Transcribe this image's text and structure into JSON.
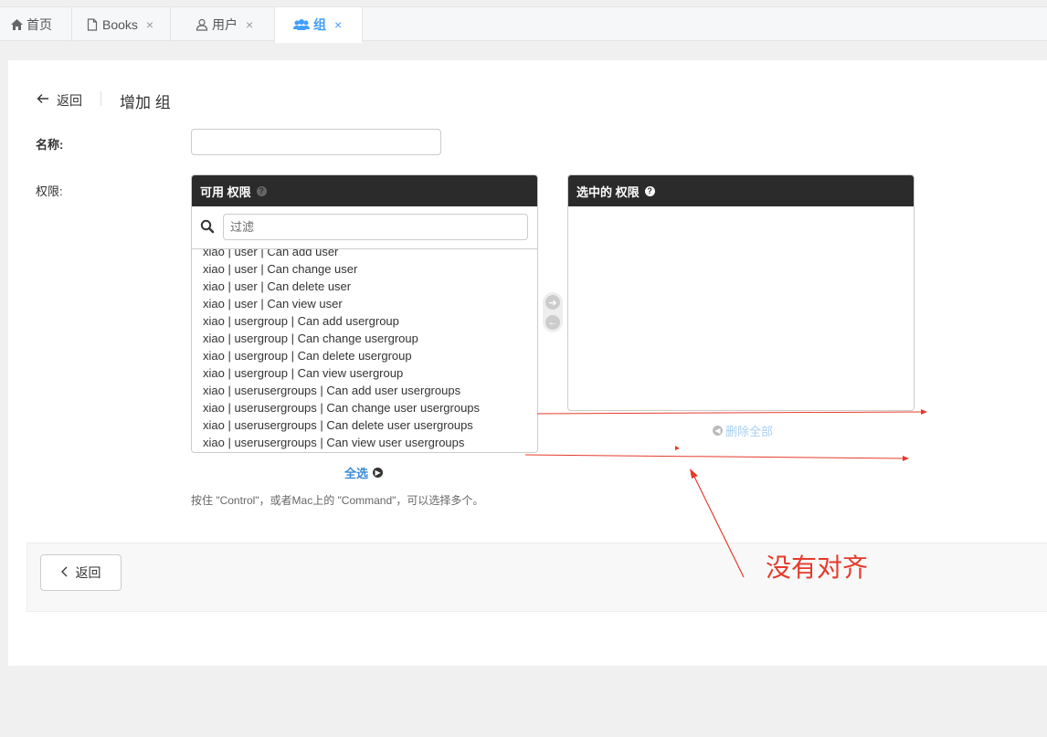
{
  "tabs": [
    {
      "label": "首页",
      "icon": "home-icon",
      "closable": false,
      "active": false
    },
    {
      "label": "Books",
      "icon": "file-icon",
      "closable": true,
      "active": false
    },
    {
      "label": "用户",
      "icon": "user-icon",
      "closable": true,
      "active": false
    },
    {
      "label": "组",
      "icon": "users-icon",
      "closable": true,
      "active": true
    }
  ],
  "tab_close_glyph": "×",
  "header": {
    "back_label": "返回",
    "title": "增加 组"
  },
  "form": {
    "name_label": "名称:",
    "name_value": "",
    "permissions_label": "权限:"
  },
  "available": {
    "title": "可用 权限",
    "filter_placeholder": "过滤",
    "options": [
      "xiao | user | Can add user",
      "xiao | user | Can change user",
      "xiao | user | Can delete user",
      "xiao | user | Can view user",
      "xiao | usergroup | Can add usergroup",
      "xiao | usergroup | Can change usergroup",
      "xiao | usergroup | Can delete usergroup",
      "xiao | usergroup | Can view usergroup",
      "xiao | userusergroups | Can add user usergroups",
      "xiao | userusergroups | Can change user usergroups",
      "xiao | userusergroups | Can delete user usergroups",
      "xiao | userusergroups | Can view user usergroups"
    ],
    "choose_all": "全选"
  },
  "chosen": {
    "title": "选中的 权限",
    "remove_all": "删除全部"
  },
  "help_text": "按住 \"Control\"，或者Mac上的 \"Command\"，可以选择多个。",
  "footer": {
    "back_label": "返回"
  },
  "annotation": {
    "text": "没有对齐",
    "color": "#e53a2b"
  }
}
